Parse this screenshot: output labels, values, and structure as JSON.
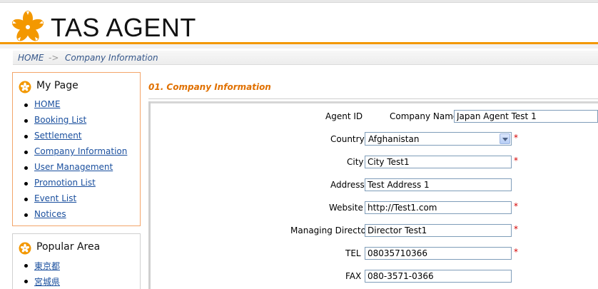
{
  "brand": {
    "name": "TAS AGENT",
    "accent": "#f39800",
    "logo_icon": "orange-flower-logo"
  },
  "breadcrumb": {
    "home": "HOME",
    "separator": "->",
    "current": "Company Information"
  },
  "sidebar": {
    "mypage": {
      "title": "My Page",
      "icon": "orange-flower-bullet",
      "items": [
        {
          "label": "HOME"
        },
        {
          "label": "Booking List"
        },
        {
          "label": "Settlement"
        },
        {
          "label": "Company Information"
        },
        {
          "label": "User Management"
        },
        {
          "label": "Promotion List"
        },
        {
          "label": "Event List"
        },
        {
          "label": "Notices"
        }
      ]
    },
    "popular": {
      "title": "Popular Area",
      "icon": "orange-flower-bullet",
      "items": [
        {
          "label": "東京都"
        },
        {
          "label": "宮城県"
        }
      ]
    }
  },
  "main": {
    "section_title": "01. Company Information",
    "form": {
      "agent_id_label": "Agent ID",
      "company_name_label": "Company Name",
      "company_name_value": "Japan Agent Test 1",
      "country_label": "Country",
      "country_value": "Afghanistan",
      "city_label": "City",
      "city_value": "City Test1",
      "address_label": "Address",
      "address_value": "Test Address 1",
      "website_label": "Website",
      "website_value": "http://Test1.com",
      "director_label": "Managing Director",
      "director_value": "Director Test1",
      "tel_label": "TEL",
      "tel_value": "08035710366",
      "fax_label": "FAX",
      "fax_value": "080-3571-0366",
      "required_mark": "*",
      "required_color": "#d40000"
    }
  }
}
